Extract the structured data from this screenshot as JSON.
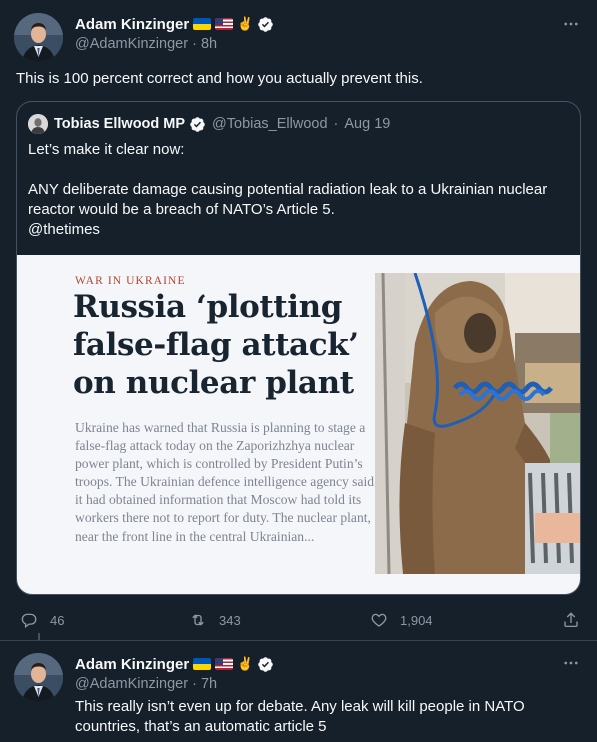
{
  "tweet1": {
    "display_name": "Adam Kinzinger",
    "emojis": [
      "flag-ukraine",
      "flag-usa",
      "victory-hand"
    ],
    "handle": "@AdamKinzinger",
    "time": "8h",
    "text": "This is 100 percent correct and how you actually prevent this.",
    "quote": {
      "display_name": "Tobias Ellwood MP",
      "handle": "@Tobias_Ellwood",
      "date": "Aug 19",
      "line1": "Let’s make it clear now:",
      "line2": "ANY deliberate damage causing potential radiation leak to a Ukrainian nuclear reactor would be a breach of NATO’s Article 5.",
      "line3": "@thetimes",
      "image": {
        "kicker": "WAR IN UKRAINE",
        "headline": "Russia ‘plotting false-flag attack’ on nuclear plant",
        "article": "Ukraine has warned that Russia is planning to stage a false-flag attack today on the Zaporizhzhya nuclear power plant, which is controlled by President Putin’s troops. The Ukrainian defence intelligence agency said it had obtained information that Moscow had told its workers there not to report for duty. The nuclear plant, near the front line in the central Ukrainian..."
      }
    },
    "actions": {
      "replies": "46",
      "retweets": "343",
      "likes": "1,904"
    }
  },
  "tweet2": {
    "display_name": "Adam Kinzinger",
    "handle": "@AdamKinzinger",
    "time": "7h",
    "text": "This really isn’t even up for debate.  Any leak will kill people in NATO countries, that’s an automatic article 5"
  },
  "colors": {
    "background": "#15202b",
    "text": "#f7f9f9",
    "secondary": "#8b98a5",
    "border": "#425364",
    "verified": "#ffffff"
  }
}
